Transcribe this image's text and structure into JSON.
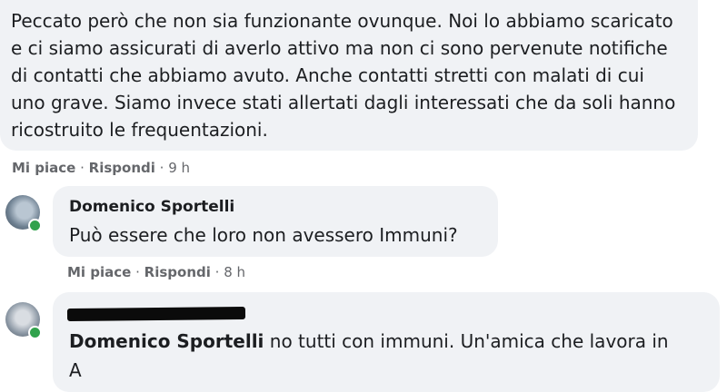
{
  "comment1": {
    "text": "Peccato però che non sia funzionante ovunque. Noi lo abbiamo scaricato e ci siamo assicurati di averlo attivo ma non ci sono pervenute notifiche di contatti che abbiamo avuto. Anche contatti stretti con malati di cui uno grave. Siamo invece stati allertati dagli interessati che da soli hanno ricostruito le frequentazioni.",
    "like": "Mi piace",
    "reply": "Rispondi",
    "time": "9 h"
  },
  "reply1": {
    "author": "Domenico Sportelli",
    "text": "Può essere che loro non avessero Immuni?",
    "like": "Mi piace",
    "reply": "Rispondi",
    "time": "8 h"
  },
  "reply2": {
    "mention": "Domenico Sportelli",
    "text": " no tutti con immuni. Un'amica che lavora in",
    "text_cut": "A"
  },
  "separator": " · "
}
